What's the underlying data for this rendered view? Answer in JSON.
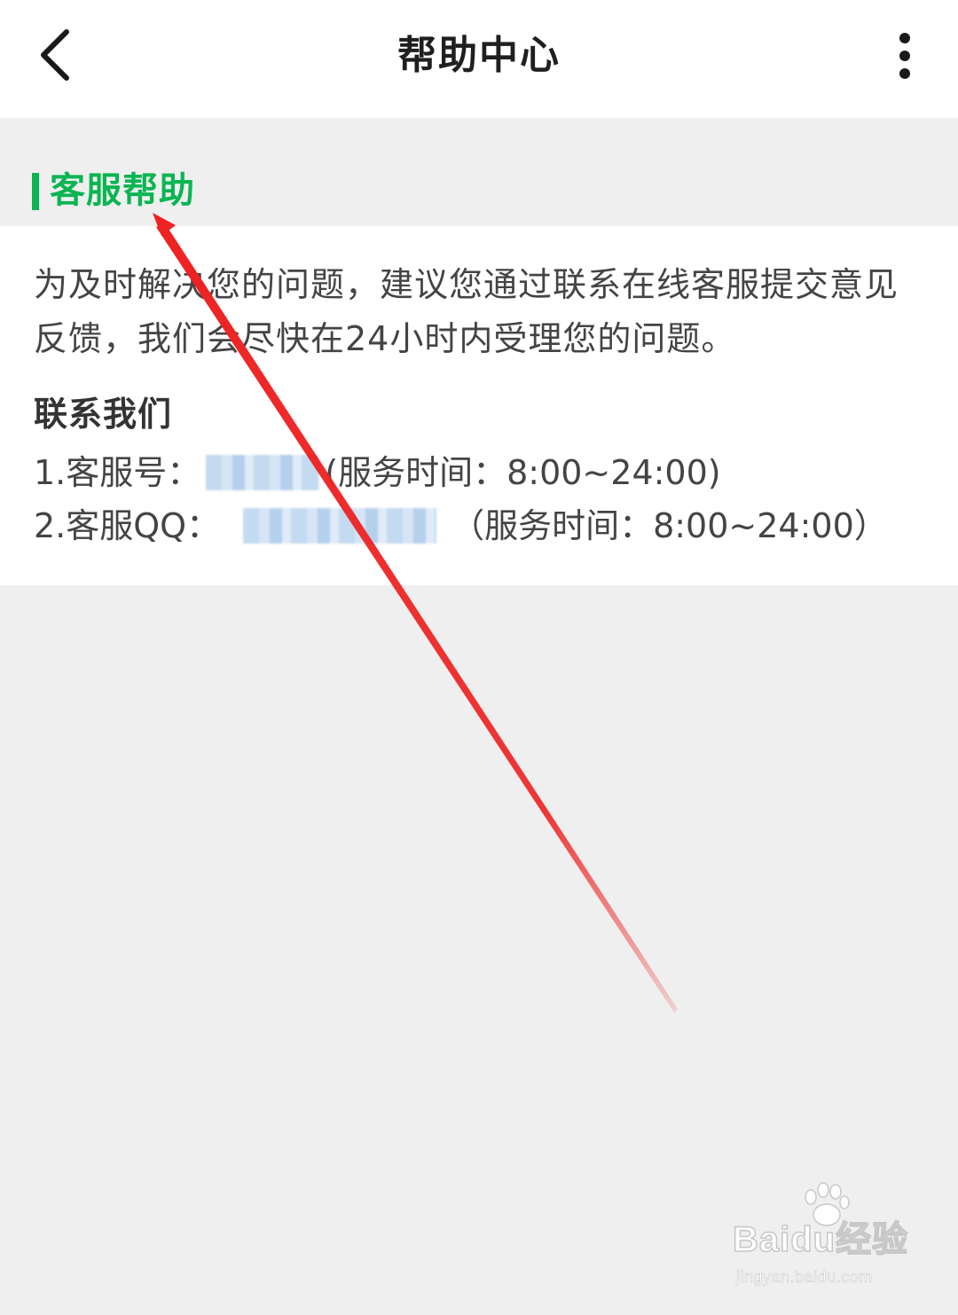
{
  "navbar": {
    "title": "帮助中心",
    "back_icon": "chevron-left-icon",
    "more_icon": "more-vertical-icon"
  },
  "section": {
    "title": "客服帮助",
    "accent_color": "#0ab552"
  },
  "content": {
    "intro": "为及时解决您的问题，建议您通过联系在线客服提交意见反馈，我们会尽快在24小时内受理您的问题。",
    "contact_heading": "联系我们",
    "line1_prefix": "1.客服号：",
    "line1_suffix": "(服务时间：8:00~24:00)",
    "line2_prefix": "2.客服QQ：",
    "line2_suffix": "（服务时间：8:00~24:00）"
  },
  "annotation": {
    "type": "arrow",
    "color": "#ee2222"
  },
  "watermark": {
    "logo": "Baidu经验",
    "url": "jingyan.baidu.com"
  }
}
